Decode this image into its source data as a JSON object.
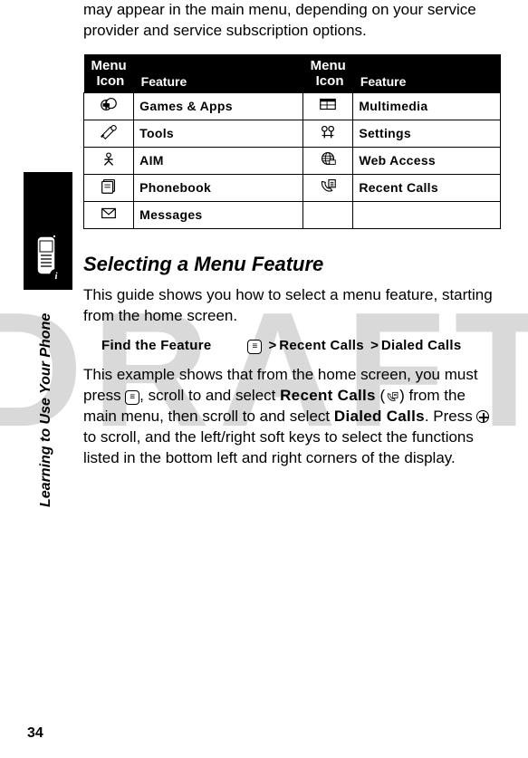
{
  "watermark": "DRAFT",
  "intro": "may appear in the main menu, depending on your service provider and service subscription options.",
  "table": {
    "head": {
      "left_l1": "Menu",
      "left_l2": "Icon",
      "left_feature": "Feature",
      "right_l1": "Menu",
      "right_l2": "Icon",
      "right_feature": "Feature"
    },
    "rows": [
      {
        "left_feat": "Games & Apps",
        "right_feat": "Multimedia"
      },
      {
        "left_feat": "Tools",
        "right_feat": "Settings"
      },
      {
        "left_feat": "AIM",
        "right_feat": "Web Access"
      },
      {
        "left_feat": "Phonebook",
        "right_feat": "Recent Calls"
      },
      {
        "left_feat": "Messages",
        "right_feat": ""
      }
    ]
  },
  "section_title": "Selecting a Menu Feature",
  "para1": "This guide shows you how to select a menu feature, starting from the home screen.",
  "find": {
    "label": "Find the Feature",
    "step1": "Recent Calls",
    "step2": "Dialed Calls"
  },
  "para2a": "This example shows that from the home screen, you must press ",
  "para2b": ", scroll to and select ",
  "para2c": " (",
  "para2d": ") from the main menu, then scroll to and select ",
  "para2e": ". Press ",
  "para2f": " to scroll, and the left/right soft keys to select the functions listed in the bottom left and right corners of the display.",
  "recent_calls": "Recent Calls",
  "dialed_calls": "Dialed Calls",
  "side_label": "Learning to Use Your Phone",
  "page_number": "34",
  "menu_key_label": "≡"
}
